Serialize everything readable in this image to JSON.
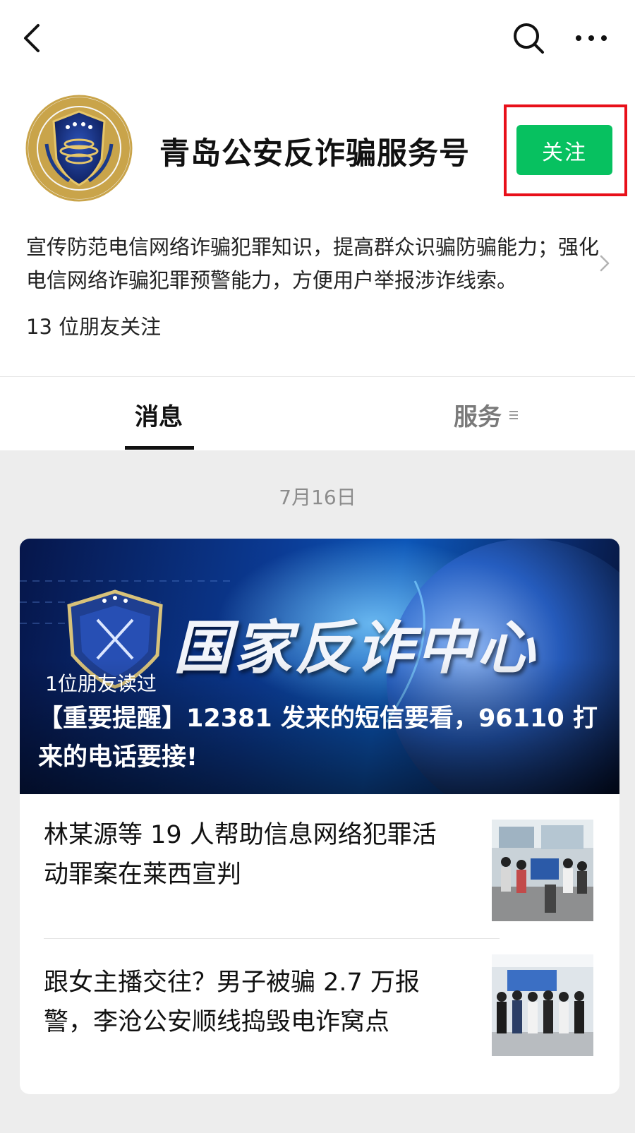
{
  "header": {
    "back_icon": "chevron-left-icon",
    "search_icon": "search-icon",
    "more_icon": "more-dots-icon"
  },
  "profile": {
    "name": "青岛公安反诈骗服务号",
    "follow_label": "关注",
    "follow_color": "#07c160",
    "highlight_color": "#e8101a",
    "description": "宣传防范电信网络诈骗犯罪知识，提高群众识骗防骗能力；强化电信网络诈骗犯罪预警能力，方便用户举报涉诈线索。",
    "followers": "13 位朋友关注"
  },
  "tabs": [
    {
      "label": "消息",
      "active": true
    },
    {
      "label": "服务",
      "active": false
    }
  ],
  "feed": {
    "date": "7月16日",
    "featured": {
      "banner_headline": "国家反诈中心",
      "read_by": "1位朋友读过",
      "title": "【重要提醒】12381 发来的短信要看，96110 打来的电话要接!"
    },
    "articles": [
      {
        "title": "林某源等 19 人帮助信息网络犯罪活动罪案在莱西宣判"
      },
      {
        "title": "跟女主播交往？男子被骗 2.7 万报警，李沧公安顺线捣毁电诈窝点"
      }
    ]
  }
}
